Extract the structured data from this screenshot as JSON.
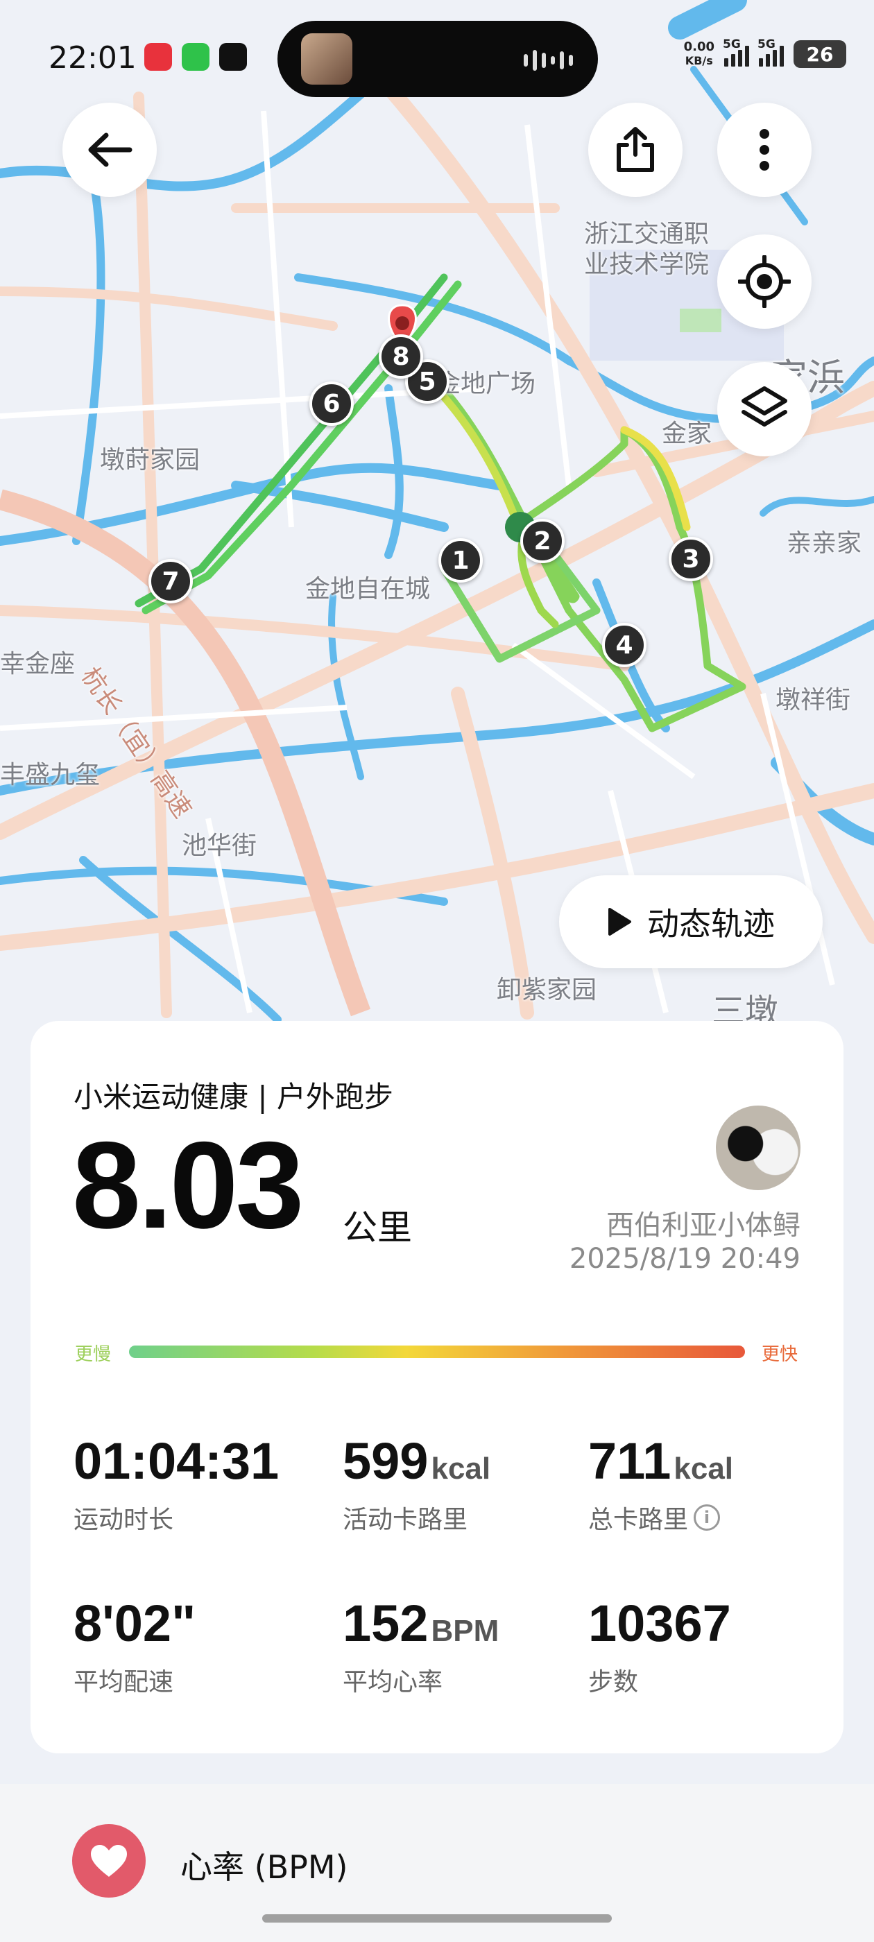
{
  "status_bar": {
    "time": "22:01",
    "net_speed_value": "0.00",
    "net_speed_unit": "KB/s",
    "sim1": "5G",
    "sim2": "5G",
    "battery": "26"
  },
  "map": {
    "labels": [
      "浙江交通职",
      "业技术学院",
      "金地广场",
      "金家",
      "亲亲家",
      "墩莳家园",
      "金地自在城",
      "杭长（宜）高速",
      "幸金座",
      "丰盛九玺",
      "池华街",
      "墩祥街",
      "卸紫家园",
      "三墩",
      "家浜"
    ],
    "markers": [
      "1",
      "2",
      "3",
      "4",
      "5",
      "6",
      "7",
      "8"
    ],
    "replay_label": "动态轨迹"
  },
  "summary": {
    "source": "小米运动健康 | 户外跑步",
    "distance": "8.03",
    "distance_unit": "公里",
    "user": "西伯利亚小体鲟",
    "datetime": "2025/8/19 20:49",
    "pace_slow": "更慢",
    "pace_fast": "更快"
  },
  "stats": [
    {
      "value": "01:04:31",
      "unit": "",
      "label": "运动时长"
    },
    {
      "value": "599",
      "unit": "kcal",
      "label": "活动卡路里"
    },
    {
      "value": "711",
      "unit": "kcal",
      "label": "总卡路里"
    },
    {
      "value": "8'02\"",
      "unit": "",
      "label": "平均配速"
    },
    {
      "value": "152",
      "unit": "BPM",
      "label": "平均心率"
    },
    {
      "value": "10367",
      "unit": "",
      "label": "步数"
    }
  ],
  "heart_section": {
    "title": "心率 (BPM)"
  },
  "colors": {
    "route_green": "#5fcf5f",
    "route_yellow": "#e8e04a",
    "heart": "#e25a6a",
    "water": "#62b9ec",
    "road": "#f7d9c9"
  }
}
